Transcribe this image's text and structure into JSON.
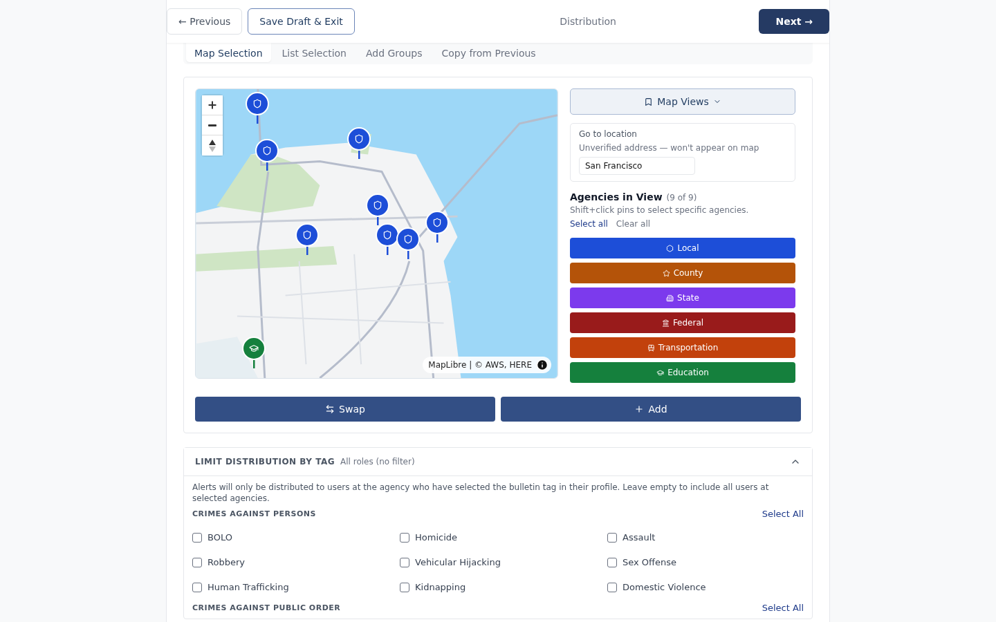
{
  "header": {
    "previous": "← Previous",
    "save": "Save Draft & Exit",
    "title": "Distribution",
    "next": "Next →"
  },
  "tabs": [
    {
      "label": "Map Selection",
      "selected": true
    },
    {
      "label": "List Selection",
      "selected": false
    },
    {
      "label": "Add Groups",
      "selected": false
    },
    {
      "label": "Copy from Previous",
      "selected": false
    }
  ],
  "map": {
    "pins": [
      {
        "kind": "local"
      },
      {
        "kind": "local"
      },
      {
        "kind": "local"
      },
      {
        "kind": "local"
      },
      {
        "kind": "local"
      },
      {
        "kind": "local"
      },
      {
        "kind": "local"
      },
      {
        "kind": "local"
      },
      {
        "kind": "education"
      }
    ],
    "attribution": "MapLibre | © AWS, HERE"
  },
  "map_views": {
    "label": "Map Views"
  },
  "location": {
    "title": "Go to location",
    "note": "Unverified address — won't appear on map",
    "value": "San Francisco"
  },
  "agencies": {
    "title": "Agencies in View",
    "count": "(9 of 9)",
    "hint": "Shift+click pins to select specific agencies.",
    "select_all": "Select all",
    "clear_all": "Clear all",
    "types": [
      {
        "kind": "local",
        "label": "Local",
        "color": "#1d4ed8"
      },
      {
        "kind": "county",
        "label": "County",
        "color": "#b45309"
      },
      {
        "kind": "state",
        "label": "State",
        "color": "#7c3aed"
      },
      {
        "kind": "federal",
        "label": "Federal",
        "color": "#991b1b"
      },
      {
        "kind": "transportation",
        "label": "Transportation",
        "color": "#c2410c"
      },
      {
        "kind": "education",
        "label": "Education",
        "color": "#15803d"
      }
    ]
  },
  "actions": {
    "swap": "Swap",
    "add": "Add"
  },
  "tag_filter": {
    "title": "LIMIT DISTRIBUTION BY TAG",
    "summary": "All roles (no filter)",
    "expanded": true,
    "description": "Alerts will only be distributed to users at the agency who have selected the bulletin tag in their profile. Leave empty to include all users at selected agencies.",
    "groups": [
      {
        "title": "CRIMES AGAINST PERSONS",
        "select_all": "Select All",
        "tags": [
          {
            "label": "BOLO",
            "checked": false
          },
          {
            "label": "Homicide",
            "checked": false
          },
          {
            "label": "Assault",
            "checked": false
          },
          {
            "label": "Robbery",
            "checked": false
          },
          {
            "label": "Vehicular Hijacking",
            "checked": false
          },
          {
            "label": "Sex Offense",
            "checked": false
          },
          {
            "label": "Human Trafficking",
            "checked": false
          },
          {
            "label": "Kidnapping",
            "checked": false
          },
          {
            "label": "Domestic Violence",
            "checked": false
          }
        ]
      },
      {
        "title": "CRIMES AGAINST PUBLIC ORDER",
        "select_all": "Select All"
      }
    ]
  }
}
